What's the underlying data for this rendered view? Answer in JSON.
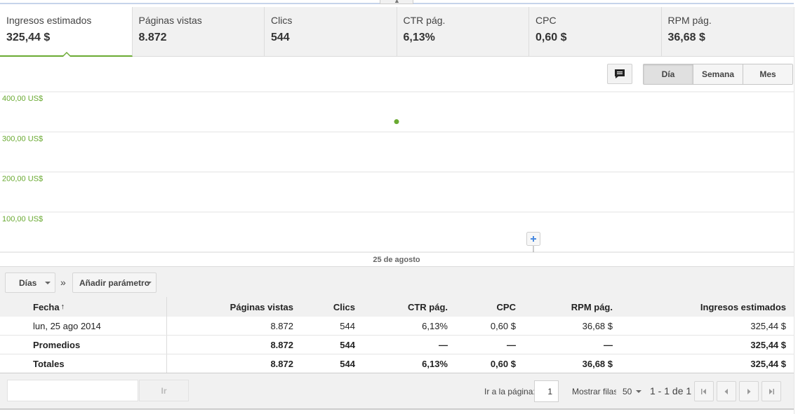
{
  "metrics": [
    {
      "label": "Ingresos estimados",
      "value": "325,44 $",
      "active": true
    },
    {
      "label": "Páginas vistas",
      "value": "8.872"
    },
    {
      "label": "Clics",
      "value": "544"
    },
    {
      "label": "CTR pág.",
      "value": "6,13%"
    },
    {
      "label": "CPC",
      "value": "0,60 $"
    },
    {
      "label": "RPM pág.",
      "value": "36,68 $"
    }
  ],
  "chart_toolbar": {
    "annotation_icon": "comment-icon",
    "periods": [
      "Día",
      "Semana",
      "Mes"
    ],
    "selected_period": "Día"
  },
  "chart_data": {
    "type": "scatter",
    "title": "",
    "xlabel": "",
    "ylabel": "",
    "x_ticks": [
      "25 de agosto"
    ],
    "y_ticks": [
      "100,00 US$",
      "200,00 US$",
      "300,00 US$",
      "400,00 US$"
    ],
    "ylim": [
      0,
      400
    ],
    "grid": true,
    "series": [
      {
        "values": [
          325.44
        ],
        "x": [
          "25 de agosto"
        ],
        "color": "#6aaa32"
      }
    ],
    "annotation_marker": "plus-icon"
  },
  "dimensions": {
    "dimension_label": "Días",
    "separator": "»",
    "add_param_label": "Añadir parámetro"
  },
  "table": {
    "headers": {
      "date": "Fecha",
      "sort_icon": "↑",
      "pv": "Páginas vistas",
      "clics": "Clics",
      "ctr": "CTR pág.",
      "cpc": "CPC",
      "rpm": "RPM pág.",
      "ingresos": "Ingresos estimados"
    },
    "rows": [
      {
        "date": "lun, 25 ago 2014",
        "pv": "8.872",
        "clics": "544",
        "ctr": "6,13%",
        "cpc": "0,60 $",
        "rpm": "36,68 $",
        "ingresos": "325,44 $"
      },
      {
        "date": "Promedios",
        "pv": "8.872",
        "clics": "544",
        "ctr": "—",
        "cpc": "—",
        "rpm": "—",
        "ingresos": "325,44 $"
      },
      {
        "date": "Totales",
        "pv": "8.872",
        "clics": "544",
        "ctr": "6,13%",
        "cpc": "0,60 $",
        "rpm": "36,68 $",
        "ingresos": "325,44 $"
      }
    ]
  },
  "pager": {
    "filter_value": "",
    "go_label": "Ir",
    "goto_label": "Ir a la página:",
    "page_value": "1",
    "rows_label": "Mostrar filas:",
    "rows_value": "50",
    "range": "1 - 1 de 1"
  }
}
